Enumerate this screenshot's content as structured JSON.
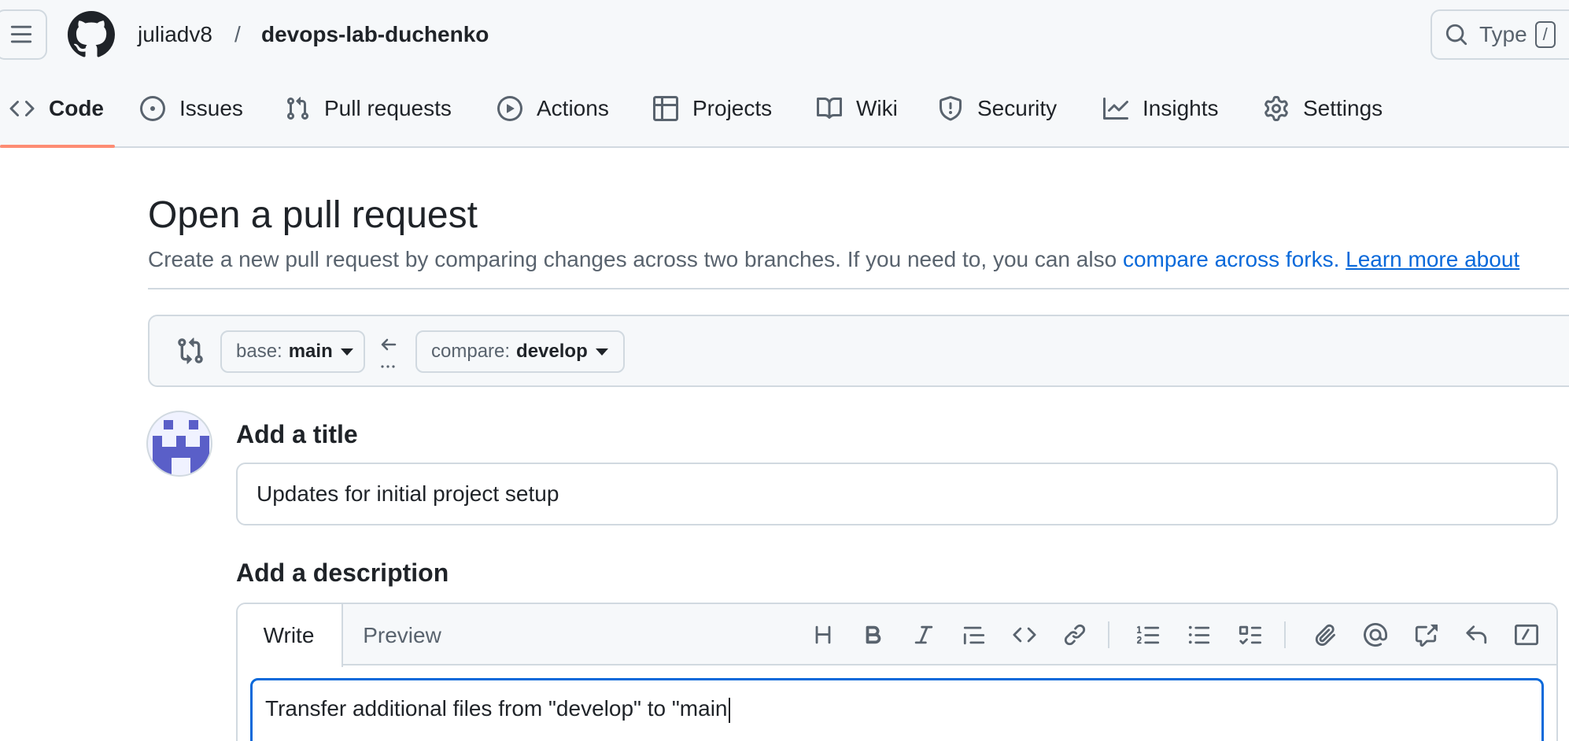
{
  "header": {
    "owner": "juliadv8",
    "separator": "/",
    "repo": "devops-lab-duchenko",
    "search_placeholder": "Type",
    "search_shortcut": "/"
  },
  "nav": {
    "tabs": [
      {
        "label": "Code",
        "icon": "code-icon",
        "active": true
      },
      {
        "label": "Issues",
        "icon": "issue-opened-icon"
      },
      {
        "label": "Pull requests",
        "icon": "git-pull-request-icon"
      },
      {
        "label": "Actions",
        "icon": "play-icon"
      },
      {
        "label": "Projects",
        "icon": "table-icon"
      },
      {
        "label": "Wiki",
        "icon": "book-icon"
      },
      {
        "label": "Security",
        "icon": "shield-icon"
      },
      {
        "label": "Insights",
        "icon": "graph-icon"
      },
      {
        "label": "Settings",
        "icon": "gear-icon"
      }
    ],
    "active_color": "#fd8c73"
  },
  "main": {
    "title": "Open a pull request",
    "subtitle_text": "Create a new pull request by comparing changes across two branches. If you need to, you can also ",
    "compare_forks_link": "compare across forks.",
    "learn_more_link": "Learn more about"
  },
  "compare": {
    "base_prefix": "base:",
    "base_branch": "main",
    "compare_prefix": "compare:",
    "compare_branch": "develop",
    "arrow_dots": "..."
  },
  "form": {
    "title_label": "Add a title",
    "title_value": "Updates for initial project setup",
    "description_label": "Add a description",
    "write_tab": "Write",
    "preview_tab": "Preview",
    "description_value": "Transfer additional files from \"develop\" to \"main",
    "toolbar": [
      "heading-icon",
      "bold-icon",
      "italic-icon",
      "quote-icon",
      "code-icon",
      "link-icon",
      "ordered-list-icon",
      "unordered-list-icon",
      "task-list-icon",
      "paperclip-icon",
      "mention-icon",
      "cross-reference-icon",
      "reply-icon",
      "slash-command-icon"
    ]
  },
  "colors": {
    "link": "#0969da",
    "focus_border": "#0969da",
    "border": "#d1d9e0",
    "canvas_subtle": "#f6f8fa"
  }
}
